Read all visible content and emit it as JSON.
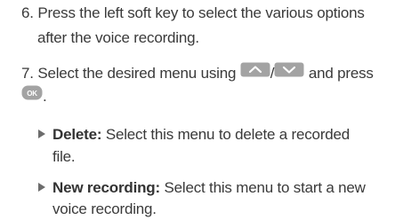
{
  "steps": [
    {
      "number": "6.",
      "line1": "Press the left soft key to select the various options",
      "line2": "after the voice recording."
    },
    {
      "number": "7.",
      "line1_a": "Select the desired menu using",
      "separator": "/",
      "line1_b": "and press",
      "ok_key": "OK",
      "line2_tail": "."
    }
  ],
  "options": [
    {
      "term": "Delete:",
      "line1": "Select this menu to delete a recorded",
      "line2": "file."
    },
    {
      "term": "New recording:",
      "line1": "Select this menu to start a new",
      "line2": "voice recording."
    }
  ],
  "icons": {
    "key_color": "#9e9e9e",
    "up": "up-key-icon",
    "down": "down-key-icon",
    "ok": "ok-key-icon"
  }
}
